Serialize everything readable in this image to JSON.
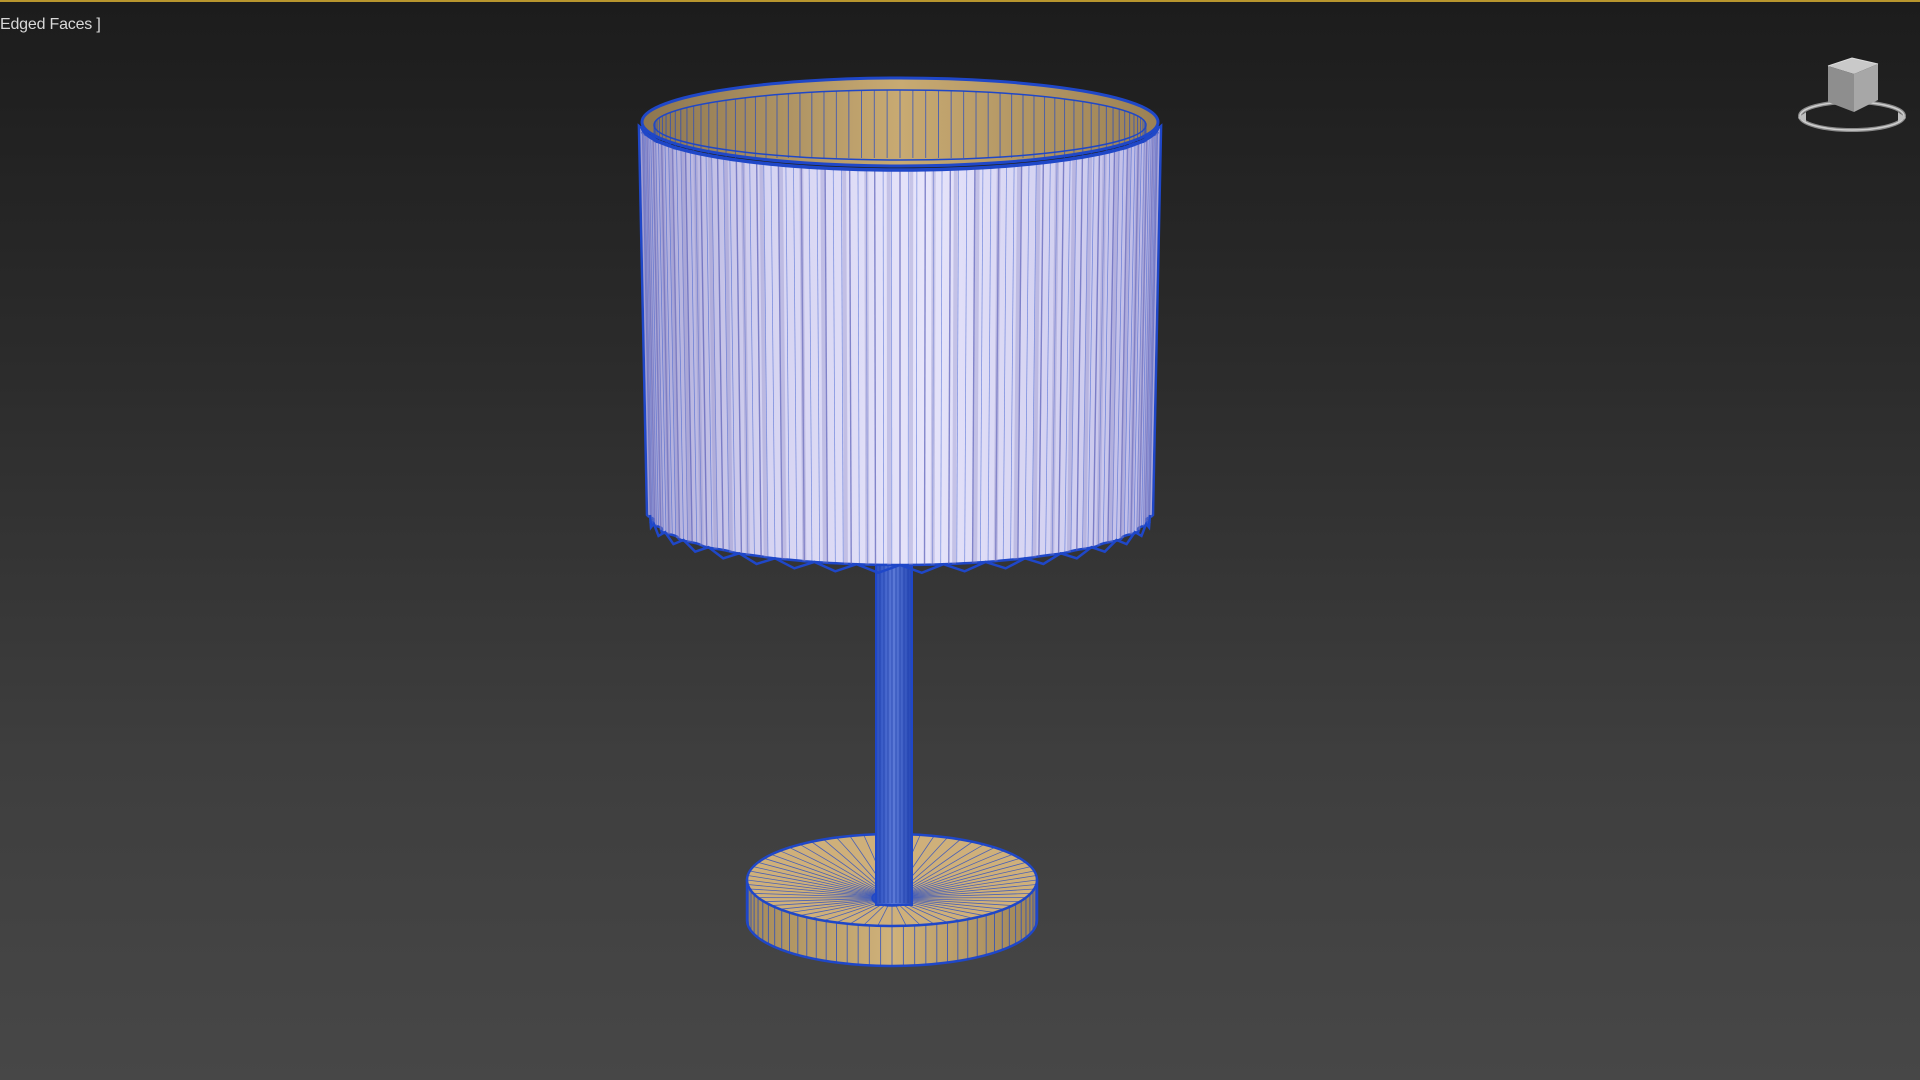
{
  "viewport": {
    "label": "Edged Faces ]",
    "background_top": "#1c1c1c",
    "background_bottom": "#474747",
    "active_border_color": "#b8962e"
  },
  "model": {
    "shade_color": "#d4d2f2",
    "inner_color": "#b89a62",
    "base_color": "#c9a86a",
    "wire_color": "#1f47c8"
  },
  "viewcube": {
    "icon": "viewcube-icon"
  }
}
